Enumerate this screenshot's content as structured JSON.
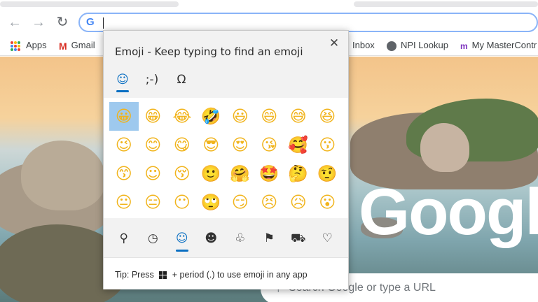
{
  "browser": {
    "omnibox_value": "",
    "bookmarks": [
      {
        "label": "Apps",
        "icon": "apps-grid-icon"
      },
      {
        "label": "Gmail",
        "icon": "gmail-icon"
      },
      {
        "label": "Inbox",
        "icon": "inbox-icon"
      },
      {
        "label": "NPI Lookup",
        "icon": "globe-icon"
      },
      {
        "label": "My MasterContr",
        "icon": "mastercontrol-icon"
      }
    ]
  },
  "new_tab": {
    "logo_text": "Google",
    "search_placeholder": "Search Google or type a URL"
  },
  "emoji_panel": {
    "title": "Emoji - Keep typing to find an emoji",
    "close_glyph": "✕",
    "category_tabs": [
      {
        "name": "emoji-tab",
        "glyph": "☺",
        "active": true
      },
      {
        "name": "kaomoji-tab",
        "glyph": ";-)",
        "active": false
      },
      {
        "name": "symbols-tab",
        "glyph": "Ω",
        "active": false
      }
    ],
    "emojis": [
      "😀",
      "😁",
      "😂",
      "🤣",
      "😃",
      "😄",
      "😅",
      "😆",
      "😉",
      "😊",
      "😋",
      "😎",
      "😍",
      "😘",
      "🥰",
      "😗",
      "😙",
      "☺",
      "😚",
      "🙂",
      "🤗",
      "🤩",
      "🤔",
      "🤨",
      "😐",
      "😑",
      "😶",
      "🙄",
      "😏",
      "😣",
      "😥",
      "😮"
    ],
    "selected_index": 0,
    "bottom_tabs": [
      {
        "name": "search-tab",
        "glyph": "⚲",
        "active": false
      },
      {
        "name": "recent-tab",
        "glyph": "◷",
        "active": false
      },
      {
        "name": "smiley-tab",
        "glyph": "☺",
        "active": true
      },
      {
        "name": "people-tab",
        "glyph": "☻",
        "active": false
      },
      {
        "name": "celebration-tab",
        "glyph": "♧",
        "active": false
      },
      {
        "name": "food-tab",
        "glyph": "⚑",
        "active": false
      },
      {
        "name": "transport-tab",
        "glyph": "⛟",
        "active": false
      },
      {
        "name": "heart-tab",
        "glyph": "♡",
        "active": false
      }
    ],
    "tip_prefix": "Tip: Press",
    "tip_suffix": "+ period (.) to use emoji in any app"
  },
  "colors": {
    "accent": "#0a6fc2",
    "selected_cell": "#9ec9ee",
    "omnibox_focus": "#8ab4f8"
  }
}
